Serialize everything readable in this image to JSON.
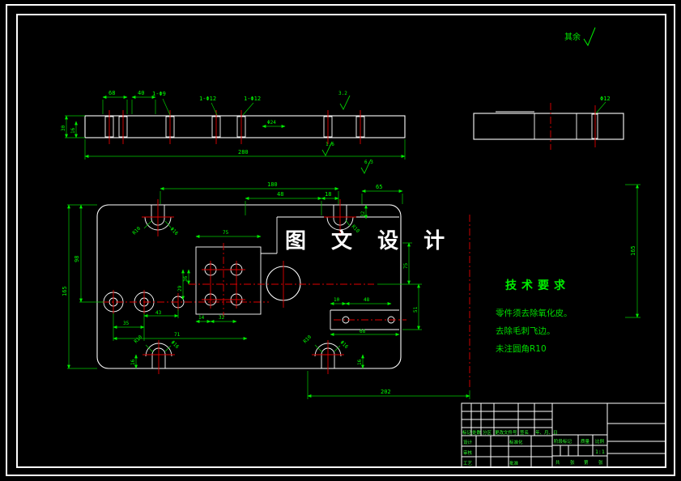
{
  "annotations": {
    "surface_note": "其余",
    "watermark": "图 文 设 计"
  },
  "tech_requirements": {
    "title": "技术要求",
    "items": [
      "零件须去除氧化皮。",
      "去除毛刺飞边。",
      "未注圆角R10"
    ]
  },
  "title_block": {
    "rev_headers": [
      "标记",
      "处数",
      "分区",
      "更改文件号",
      "签名",
      "年、月、日"
    ],
    "roles": {
      "design": "设计",
      "standard": "标准化",
      "check": "审核",
      "process": "工艺",
      "approve": "批准"
    },
    "fields": {
      "stage": "阶段标记",
      "weight": "质量",
      "scale": "比例",
      "scale_value": "1:1"
    },
    "sheet_words": [
      "共",
      "张",
      "第",
      "张"
    ]
  },
  "colors": {
    "dimension_green": "#00ff00",
    "centerline_red": "#e00000",
    "hatch_cyan": "#7fe7e7",
    "edge_white": "#ffffff",
    "background": "#000000"
  },
  "dims": {
    "d1": "68",
    "d2": "40",
    "d3": "1-Φ9",
    "d4": "1-Φ12",
    "d5": "1-Φ12",
    "d6": "Φ24",
    "d7": "280",
    "d8": "30",
    "d9": "16",
    "d10": "3.2",
    "d11": "1.6",
    "d12": "6.3",
    "d13": "Φ12",
    "d14": "165",
    "d15": "180",
    "d16": "48",
    "d17": "18",
    "d18": "65",
    "d19": "32",
    "d20": "165",
    "d21": "98",
    "d22": "75",
    "d23": "36",
    "d24": "29",
    "d25": "14",
    "d26": "32",
    "d27": "43",
    "d28": "35",
    "d29": "71",
    "d30": "R10",
    "d31": "Φ16",
    "d32": "R10",
    "d33": "R10",
    "d34": "Φ16",
    "d35": "16",
    "d36": "R10",
    "d37": "Φ16",
    "d38": "16",
    "d39": "10",
    "d40": "48",
    "d41": "68",
    "d42": "202",
    "d43": "75",
    "d44": "51"
  }
}
